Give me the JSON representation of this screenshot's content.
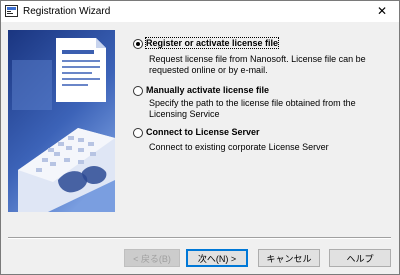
{
  "window": {
    "title": "Registration Wizard",
    "close_glyph": "✕",
    "app_icon": "registration-app-icon"
  },
  "options": [
    {
      "label": "Register or activate license file",
      "description": "Request license file from Nanosoft. License file can be requested online or by e-mail.",
      "selected": true
    },
    {
      "label": "Manually activate license file",
      "description": "Specify the path to the license file obtained from the Licensing Service",
      "selected": false
    },
    {
      "label": "Connect to License Server",
      "description": "Connect to existing corporate License Server",
      "selected": false
    }
  ],
  "buttons": {
    "back": "< 戻る(B)",
    "next": "次へ(N) >",
    "cancel": "キャンセル",
    "help": "ヘルプ"
  },
  "colors": {
    "art_top": "#1e3a8a",
    "art_bottom": "#6b8fd6",
    "default_button_border": "#0078d7"
  }
}
